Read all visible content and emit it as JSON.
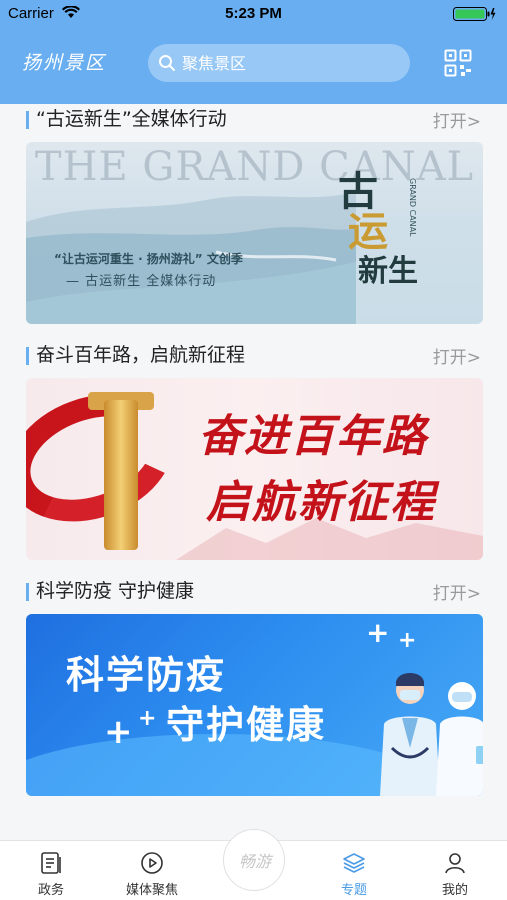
{
  "status_bar": {
    "carrier": "Carrier",
    "time": "5:23 PM"
  },
  "header": {
    "logo_text": "扬州景区",
    "search_placeholder": "聚焦景区",
    "qr_icon": "qr-code-icon"
  },
  "sections": [
    {
      "title": "“古运新生”全媒体行动",
      "open_label": "打开>",
      "banner": {
        "bg_text": "THE GRAND CANAL",
        "caption_line1": "“让古运河重生 · 扬州游礼” 文创季",
        "caption_line2": "— 古运新生  全媒体行动",
        "big_title_1": "古",
        "big_title_2": "运",
        "big_title_3": "新生",
        "side_text": "GRAND CANAL"
      }
    },
    {
      "title": "奋斗百年路，启航新征程",
      "open_label": "打开>",
      "banner": {
        "line1": "奋进百年路",
        "line2": "启航新征程"
      }
    },
    {
      "title": "科学防疫 守护健康",
      "open_label": "打开>",
      "banner": {
        "line1": "科学防疫",
        "line2": "守护健康"
      }
    }
  ],
  "tabbar": {
    "tabs": [
      {
        "label": "政务",
        "icon": "news-doc-icon"
      },
      {
        "label": "媒体聚焦",
        "icon": "play-circle-icon"
      },
      {
        "label": "专题",
        "icon": "layers-icon",
        "active": true
      },
      {
        "label": "我的",
        "icon": "user-icon"
      }
    ],
    "center_label": "畅游"
  },
  "colors": {
    "accent": "#68aef0",
    "active_tab": "#4a9be6",
    "muted": "#9a9a9a"
  }
}
